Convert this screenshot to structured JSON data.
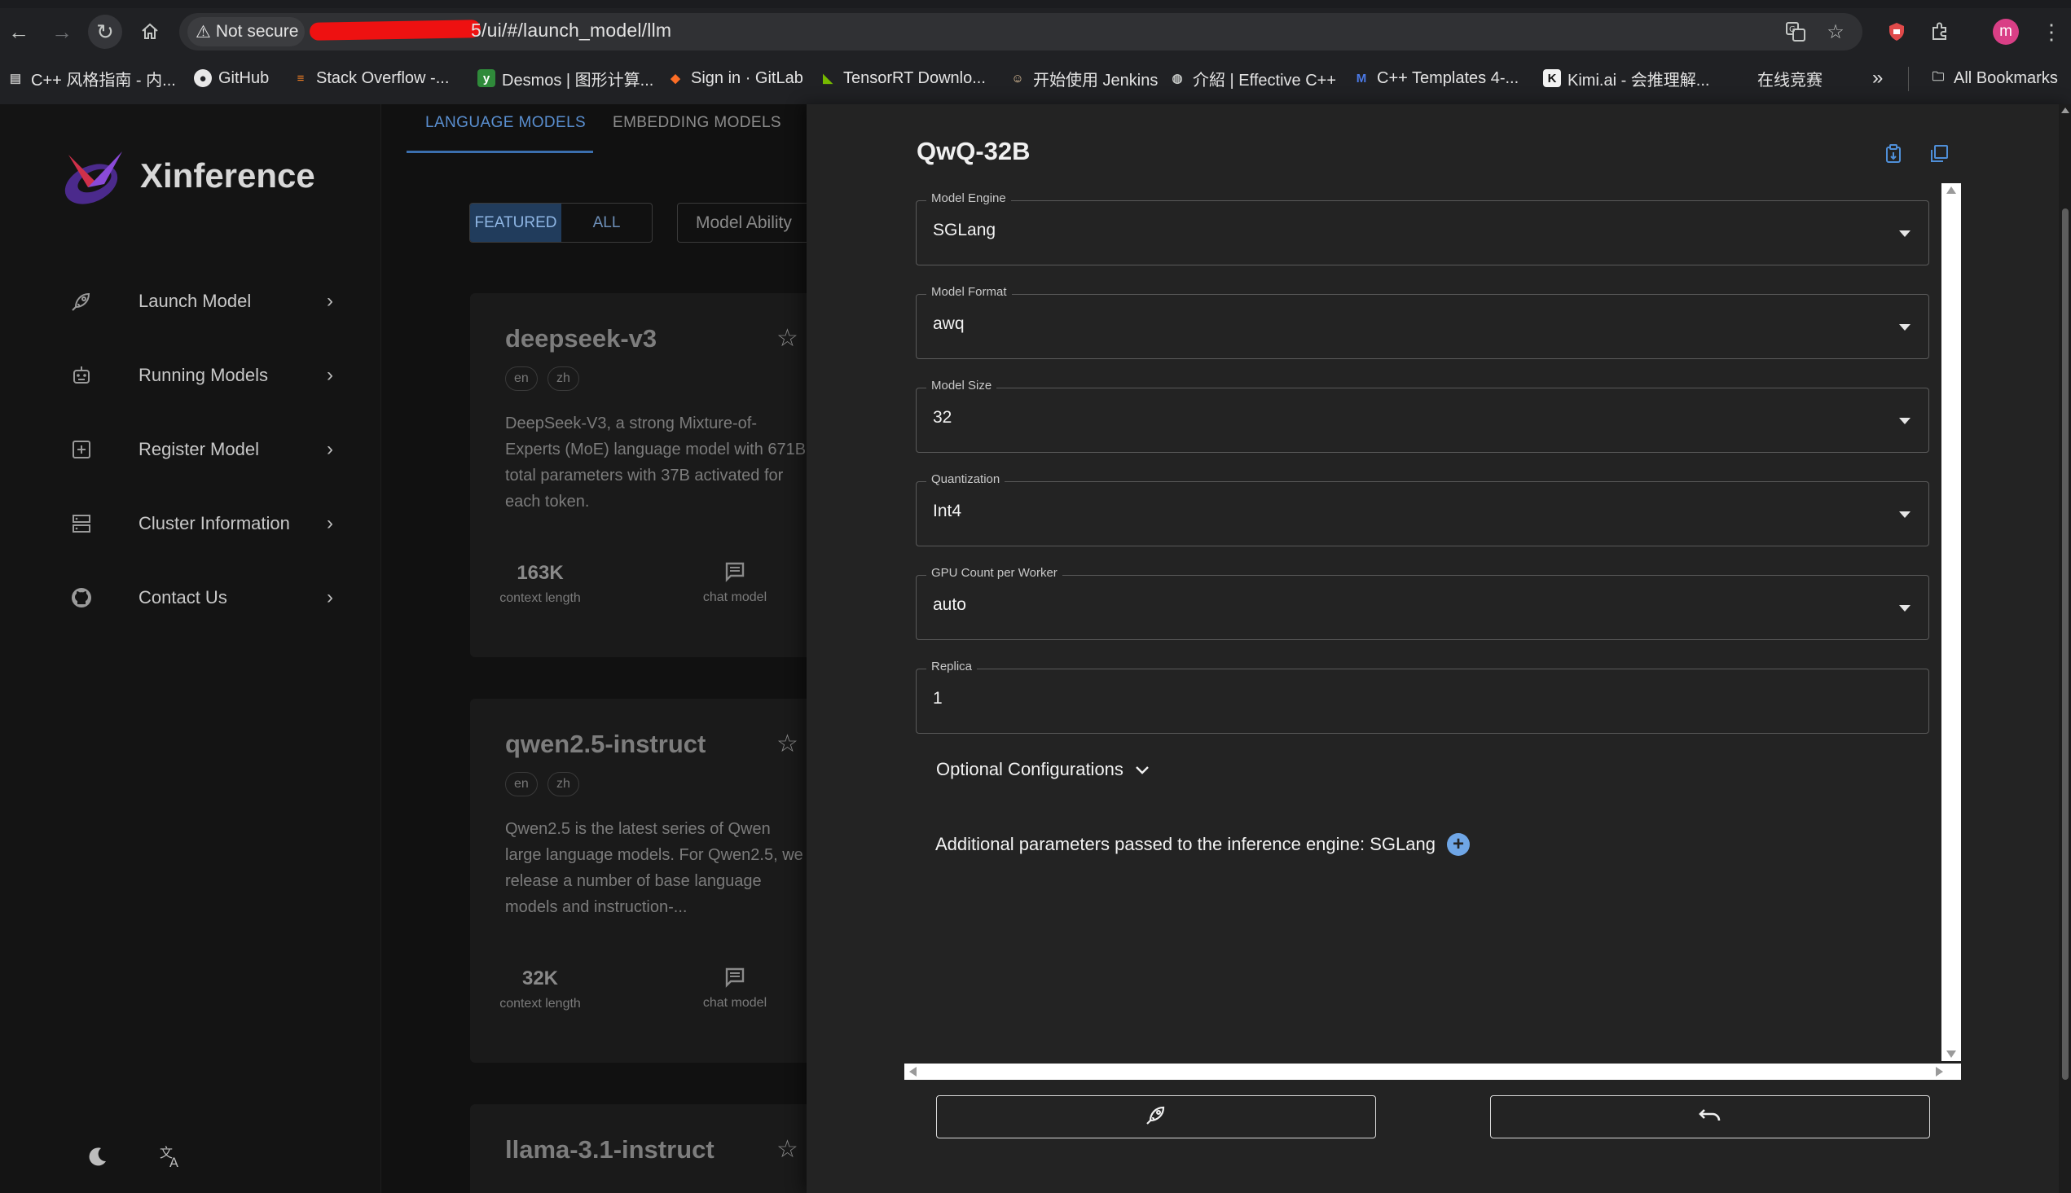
{
  "browser": {
    "security_label": "Not secure",
    "url_visible": "5/ui/#/launch_model/llm",
    "bookmarks": [
      {
        "label": "C++ 风格指南 - 内..."
      },
      {
        "label": "GitHub"
      },
      {
        "label": "Stack Overflow -..."
      },
      {
        "label": "Desmos | 图形计算..."
      },
      {
        "label": "Sign in · GitLab"
      },
      {
        "label": "TensorRT Downlo..."
      },
      {
        "label": "开始使用 Jenkins"
      },
      {
        "label": "介紹 | Effective C++"
      },
      {
        "label": "C++ Templates 4-..."
      },
      {
        "label": "Kimi.ai - 会推理解..."
      },
      {
        "label": "在线竞赛"
      }
    ],
    "overflow_label": "»",
    "all_bookmarks_label": "All Bookmarks",
    "profile_initial": "m"
  },
  "app": {
    "brand": "Xinference",
    "sidebar": {
      "items": [
        {
          "label": "Launch Model"
        },
        {
          "label": "Running Models"
        },
        {
          "label": "Register Model"
        },
        {
          "label": "Cluster Information"
        },
        {
          "label": "Contact Us"
        }
      ]
    },
    "tabs": [
      {
        "label": "LANGUAGE MODELS",
        "active": true
      },
      {
        "label": "EMBEDDING MODELS",
        "active": false
      }
    ],
    "filter": {
      "featured_label": "FEATURED",
      "all_label": "ALL",
      "ability_placeholder": "Model Ability"
    },
    "cards": [
      {
        "title": "deepseek-v3",
        "langs": [
          "en",
          "zh"
        ],
        "description": "DeepSeek-V3, a strong Mixture-of-Experts (MoE) language model with 671B total parameters with 37B activated for each token.",
        "context_length": "163K",
        "context_label": "context length",
        "ability_label": "chat model"
      },
      {
        "title": "qwen2.5-instruct",
        "langs": [
          "en",
          "zh"
        ],
        "description": "Qwen2.5 is the latest series of Qwen large language models. For Qwen2.5, we release a number of base language models and instruction-...",
        "context_length": "32K",
        "context_label": "context length",
        "ability_label": "chat model"
      },
      {
        "title": "llama-3.1-instruct"
      }
    ]
  },
  "drawer": {
    "title": "QwQ-32B",
    "fields": [
      {
        "label": "Model Engine",
        "value": "SGLang",
        "type": "select"
      },
      {
        "label": "Model Format",
        "value": "awq",
        "type": "select"
      },
      {
        "label": "Model Size",
        "value": "32",
        "type": "select"
      },
      {
        "label": "Quantization",
        "value": "Int4",
        "type": "select"
      },
      {
        "label": "GPU Count per Worker",
        "value": "auto",
        "type": "select"
      },
      {
        "label": "Replica",
        "value": "1",
        "type": "input"
      }
    ],
    "optional_config_label": "Optional Configurations",
    "additional_params_label": "Additional parameters passed to the inference engine: SGLang"
  },
  "colors": {
    "accent": "#5a8fd0",
    "drawer_bg": "#232323",
    "page_bg": "#121212",
    "add_button": "#6fa6e6"
  }
}
